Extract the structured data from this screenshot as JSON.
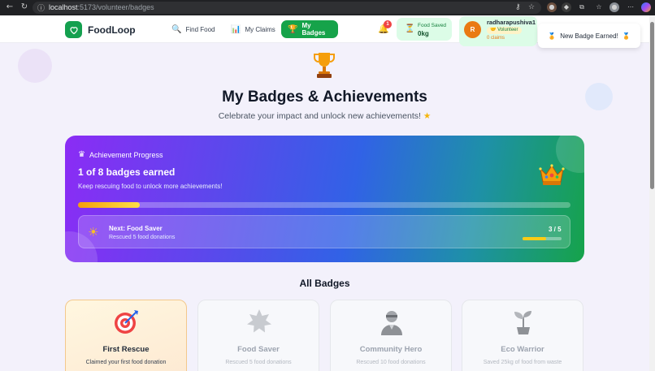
{
  "browser": {
    "url_host": "localhost",
    "url_path": ":5173/volunteer/badges"
  },
  "header": {
    "brand": "FoodLoop",
    "nav": [
      {
        "label": "Find Food",
        "icon": "magnifier-icon"
      },
      {
        "label": "My Claims",
        "icon": "bar-chart-icon"
      },
      {
        "label": "My Badges",
        "icon": "trophy-icon",
        "active": true
      }
    ],
    "notifications_count": "1",
    "food_saved_label": "Food Saved",
    "food_saved_value": "0kg",
    "user": {
      "initial": "R",
      "name": "radharapushiva1",
      "role": "Volunteer",
      "claims": "0 claims"
    },
    "toast": "New Badge Earned!"
  },
  "hero": {
    "title": "My Badges & Achievements",
    "subtitle": "Celebrate your impact and unlock new achievements!"
  },
  "progress": {
    "label": "Achievement Progress",
    "count_text": "1 of 8 badges earned",
    "message": "Keep rescuing food to unlock more achievements!",
    "earned": 1,
    "total": 8,
    "next_title": "Next: Food Saver",
    "next_desc": "Rescued 5 food donations",
    "next_count": "3 / 5",
    "next_current": 3,
    "next_target": 5
  },
  "badges_section_title": "All Badges",
  "badges": [
    {
      "name": "First Rescue",
      "desc": "Claimed your first food donation",
      "icon": "target-icon",
      "earned": true
    },
    {
      "name": "Food Saver",
      "desc": "Rescued 5 food donations",
      "icon": "star-burst-icon",
      "earned": false
    },
    {
      "name": "Community Hero",
      "desc": "Rescued 10 food donations",
      "icon": "hero-icon",
      "earned": false
    },
    {
      "name": "Eco Warrior",
      "desc": "Saved 25kg of food from waste",
      "icon": "seedling-icon",
      "earned": false
    }
  ],
  "colors": {
    "brand_green": "#16a34a",
    "gradient_start": "#8b2cf5",
    "gradient_end": "#16a34a",
    "progress_fill": "#f59e0b"
  }
}
